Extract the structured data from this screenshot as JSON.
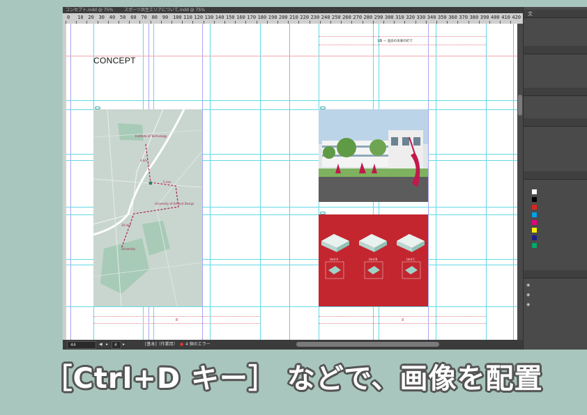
{
  "window": {
    "tabs": [
      "コンセプト.indd @ 75%",
      "スポーツ共生エリアについて.indd @ 75%"
    ]
  },
  "ruler": {
    "ticks": [
      "0",
      "10",
      "20",
      "30",
      "40",
      "50",
      "60",
      "70",
      "80",
      "90",
      "100",
      "110",
      "120",
      "130",
      "140",
      "150",
      "160",
      "170",
      "180",
      "190",
      "200",
      "210",
      "220",
      "230",
      "240",
      "250",
      "260",
      "270",
      "280",
      "290",
      "300",
      "310",
      "320",
      "330",
      "340",
      "350",
      "360",
      "370",
      "380",
      "390",
      "400",
      "410",
      "420"
    ]
  },
  "document": {
    "concept_title": "CONCEPT",
    "header_text": "1章 ー 過去の未来の町で",
    "page_numbers": [
      "8",
      "9"
    ],
    "map_labels": {
      "label1": "Institute of Technology",
      "label2": "4 km",
      "label3": "5 min",
      "label4": "University of Art and Design",
      "label5": "10 min",
      "label6": "University"
    },
    "diagram_labels": [
      "Unit A",
      "Unit B",
      "Unit C"
    ]
  },
  "statusbar": {
    "zoom": "44",
    "page_field": "4",
    "style": "[基本]（作業用）",
    "errors": "4 個のエラー"
  },
  "panel": {
    "tab_label": "文",
    "swatch_colors": [
      "#ffffff",
      "#000000",
      "#d9261c",
      "#00a0e9",
      "#e4007f",
      "#fff100",
      "#1d2088",
      "#00a968"
    ]
  },
  "caption": "［Ctrl+D キー］ などで、画像を配置",
  "colors": {
    "background": "#a8c6bd",
    "diagram_red": "#c3262f",
    "guide": "#63d8e6"
  }
}
